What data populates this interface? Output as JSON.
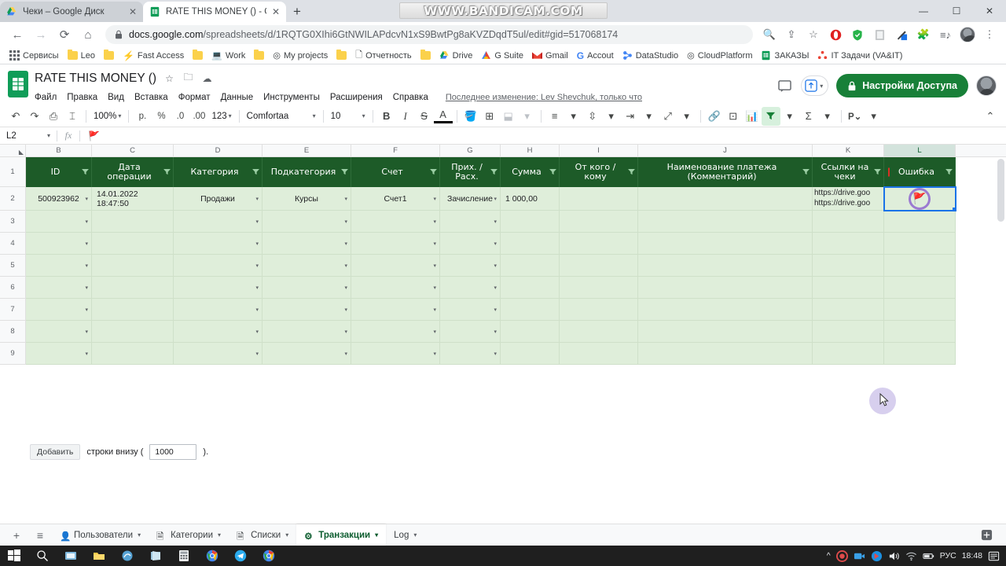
{
  "browser": {
    "watermark": "WWW.BANDICAM.COM",
    "tabs": [
      {
        "title": "Чеки – Google Диск",
        "favicon": "google-drive-icon",
        "active": false
      },
      {
        "title": "RATE THIS MONEY () - Google T",
        "favicon": "google-sheets-icon",
        "active": true
      }
    ],
    "new_tab_label": "+",
    "window_controls": {
      "minimize": "—",
      "maximize": "☐",
      "close": "✕"
    },
    "nav": {
      "back": "←",
      "forward": "→",
      "reload": "⟳",
      "home": "⌂"
    },
    "omnibox": {
      "lock_icon": "lock-icon",
      "host": "docs.google.com",
      "path": "/spreadsheets/d/1RQTG0XIhi6GtNWILAPdcvN1xS9BwtPg8aKVZDqdT5ul/edit#gid=517068174"
    },
    "omni_icons": [
      "search-icon",
      "share-icon",
      "bookmark-star-icon"
    ],
    "extensions": [
      "opera-icon",
      "shield-icon",
      "reader-icon",
      "pen-icon",
      "puzzle-icon",
      "playlist-icon"
    ],
    "profile": "profile-avatar",
    "menu": "⋮",
    "bookmarks": [
      {
        "label": "Сервисы",
        "icon": "apps-grid-icon"
      },
      {
        "label": "Leo",
        "icon": "folder-icon"
      },
      {
        "label": "Fast Access",
        "icon": "lightning-icon"
      },
      {
        "label": "Work",
        "icon": "laptop-icon"
      },
      {
        "label": "My projects",
        "icon": "target-icon"
      },
      {
        "label": "Отчетность",
        "icon": "doc-icon"
      },
      {
        "label": "Drive",
        "icon": "google-drive-icon"
      },
      {
        "label": "G Suite",
        "icon": "gsuite-icon"
      },
      {
        "label": "Gmail",
        "icon": "gmail-icon"
      },
      {
        "label": "Accout",
        "icon": "google-g-icon"
      },
      {
        "label": "DataStudio",
        "icon": "datastudio-icon"
      },
      {
        "label": "CloudPlatform",
        "icon": "cloud-platform-icon"
      },
      {
        "label": "ЗАКАЗЫ",
        "icon": "google-sheets-icon"
      },
      {
        "label": "IT Задачи (VA&IT)",
        "icon": "sites-icon"
      }
    ]
  },
  "app": {
    "logo": "google-sheets-logo",
    "doc_title": "RATE THIS MONEY ()",
    "title_icons": [
      "star-icon",
      "move-to-folder-icon",
      "cloud-saved-icon"
    ],
    "menu": [
      "Файл",
      "Правка",
      "Вид",
      "Вставка",
      "Формат",
      "Данные",
      "Инструменты",
      "Расширения",
      "Справка"
    ],
    "last_edit": "Последнее изменение: Lev Shevchuk, только что",
    "comment_icon": "comment-icon",
    "present_label": "",
    "share_button": {
      "label": "Настройки Доступа",
      "icon": "lock-icon",
      "color": "#188038"
    },
    "account_avatar": "account-avatar"
  },
  "toolbar": {
    "undo": "undo-icon",
    "redo": "redo-icon",
    "print": "print-icon",
    "paint": "paint-format-icon",
    "zoom": "100%",
    "currency": "р.",
    "percent": "%",
    "dec_decrease": ".0",
    "dec_increase": ".00",
    "formats": "123",
    "font": "Comfortaa",
    "font_size": "10",
    "bold": "B",
    "italic": "I",
    "strike": "S",
    "text_color": "A",
    "fill_color": "fill-color-icon",
    "borders": "borders-icon",
    "merge": "merge-cells-icon",
    "halign": "horizontal-align-icon",
    "valign": "vertical-align-icon",
    "wrap": "text-wrap-icon",
    "rotate": "text-rotation-icon",
    "link": "insert-link-icon",
    "comment": "insert-comment-icon",
    "chart": "insert-chart-icon",
    "filter": "filter-icon",
    "functions": "Σ",
    "macro": "Р⌄",
    "collapse": "collapse-toolbar-icon"
  },
  "formula_bar": {
    "name_box": "L2",
    "fx": "fx",
    "content": "🚩"
  },
  "grid": {
    "columns": [
      "B",
      "C",
      "D",
      "E",
      "F",
      "G",
      "H",
      "I",
      "J",
      "K",
      "L"
    ],
    "selected_column": "L",
    "header_row_number": "1",
    "headers": [
      "ID",
      "Дата операции",
      "Категория",
      "Подкатегория",
      "Счет",
      "Прих. / Расх.",
      "Сумма",
      "От кого / кому",
      "Наименование платежа (Комментарий)",
      "Ссылки на чеки",
      "Ошибка"
    ],
    "rows": [
      {
        "number": "2",
        "cells": [
          "500923962",
          "14.01.2022 18:47:50",
          "Продажи",
          "Курсы",
          "Счет1",
          "Зачисление",
          "1 000,00",
          "",
          "",
          "https://drive.goo\nhttps://drive.goo",
          "🚩"
        ]
      },
      {
        "number": "3",
        "cells": [
          "",
          "",
          "",
          "",
          "",
          "",
          "",
          "",
          "",
          "",
          ""
        ]
      },
      {
        "number": "4",
        "cells": [
          "",
          "",
          "",
          "",
          "",
          "",
          "",
          "",
          "",
          "",
          ""
        ]
      },
      {
        "number": "5",
        "cells": [
          "",
          "",
          "",
          "",
          "",
          "",
          "",
          "",
          "",
          "",
          ""
        ]
      },
      {
        "number": "6",
        "cells": [
          "",
          "",
          "",
          "",
          "",
          "",
          "",
          "",
          "",
          "",
          ""
        ]
      },
      {
        "number": "7",
        "cells": [
          "",
          "",
          "",
          "",
          "",
          "",
          "",
          "",
          "",
          "",
          ""
        ]
      },
      {
        "number": "8",
        "cells": [
          "",
          "",
          "",
          "",
          "",
          "",
          "",
          "",
          "",
          "",
          ""
        ]
      },
      {
        "number": "9",
        "cells": [
          "",
          "",
          "",
          "",
          "",
          "",
          "",
          "",
          "",
          "",
          ""
        ]
      }
    ],
    "selected_cell": "L2",
    "header_bg": "#1d5b28",
    "row_bg": "#dfeeda"
  },
  "add_rows": {
    "button": "Добавить",
    "text_before": "строки внизу (",
    "count": "1000",
    "text_after": ")."
  },
  "sheet_tabs": {
    "add": "+",
    "all_sheets": "all-sheets-icon",
    "tabs": [
      {
        "label": "Пользователи",
        "icon": "person-icon",
        "active": false
      },
      {
        "label": "Категории",
        "icon": "doc-icon",
        "active": false
      },
      {
        "label": "Списки",
        "icon": "doc-icon",
        "active": false
      },
      {
        "label": "Транзакции",
        "icon": "gear-icon",
        "active": true
      },
      {
        "label": "Log",
        "icon": "",
        "active": false
      }
    ],
    "explore": "explore-icon"
  },
  "taskbar": {
    "start": "windows-start-icon",
    "search": "search-icon",
    "apps": [
      "task-view-icon",
      "file-explorer-icon",
      "paint-icon",
      "store-icon",
      "calculator-icon",
      "chrome-icon",
      "telegram-icon",
      "chrome-icon"
    ],
    "tray": {
      "chevron": "^",
      "items": [
        "record-icon",
        "camera-icon",
        "bandicam-icon",
        "volume-icon",
        "wifi-icon",
        "battery-icon"
      ],
      "language": "РУС",
      "time": "18:48",
      "notifications": "notifications-icon"
    }
  }
}
